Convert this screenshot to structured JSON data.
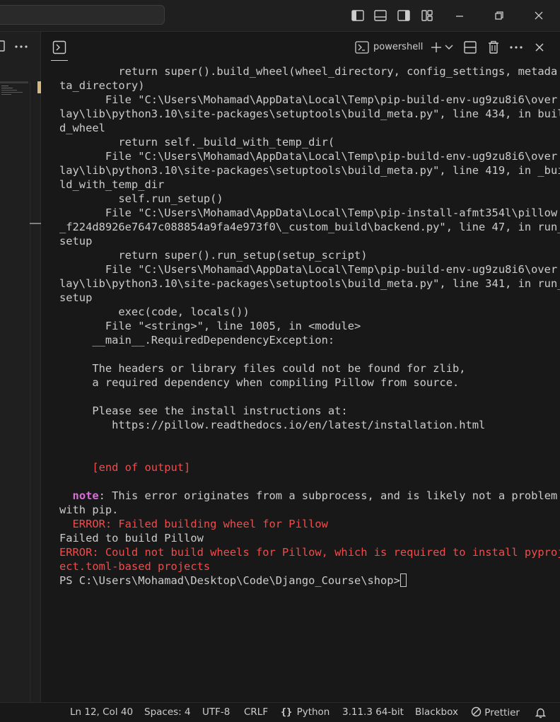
{
  "terminal_tab": {
    "label": "powershell"
  },
  "terminal_lines": [
    {
      "text": "         return super().build_wheel(wheel_directory, config_settings, metada"
    },
    {
      "text": "ta_directory)"
    },
    {
      "text": "       File \"C:\\Users\\Mohamad\\AppData\\Local\\Temp\\pip-build-env-ug9zu8i6\\over"
    },
    {
      "text": "lay\\lib\\python3.10\\site-packages\\setuptools\\build_meta.py\", line 434, in buil"
    },
    {
      "text": "d_wheel"
    },
    {
      "text": "         return self._build_with_temp_dir("
    },
    {
      "text": "       File \"C:\\Users\\Mohamad\\AppData\\Local\\Temp\\pip-build-env-ug9zu8i6\\over"
    },
    {
      "text": "lay\\lib\\python3.10\\site-packages\\setuptools\\build_meta.py\", line 419, in _bui"
    },
    {
      "text": "ld_with_temp_dir"
    },
    {
      "text": "         self.run_setup()"
    },
    {
      "text": "       File \"C:\\Users\\Mohamad\\AppData\\Local\\Temp\\pip-install-afmt354l\\pillow"
    },
    {
      "text": "_f224d8926e7647c088854a9fa4e973f0\\_custom_build\\backend.py\", line 47, in run_"
    },
    {
      "text": "setup"
    },
    {
      "text": "         return super().run_setup(setup_script)"
    },
    {
      "text": "       File \"C:\\Users\\Mohamad\\AppData\\Local\\Temp\\pip-build-env-ug9zu8i6\\over"
    },
    {
      "text": "lay\\lib\\python3.10\\site-packages\\setuptools\\build_meta.py\", line 341, in run_"
    },
    {
      "text": "setup"
    },
    {
      "text": "         exec(code, locals())"
    },
    {
      "text": "       File \"<string>\", line 1005, in <module>"
    },
    {
      "text": "     __main__.RequiredDependencyException:"
    },
    {
      "text": ""
    },
    {
      "text": "     The headers or library files could not be found for zlib,"
    },
    {
      "text": "     a required dependency when compiling Pillow from source."
    },
    {
      "text": ""
    },
    {
      "text": "     Please see the install instructions at:"
    },
    {
      "text": "        https://pillow.readthedocs.io/en/latest/installation.html"
    },
    {
      "text": ""
    },
    {
      "text": ""
    },
    {
      "text": "     [end of output]",
      "color": "red"
    },
    {
      "text": ""
    },
    {
      "prefix": "  ",
      "highlight": "note",
      "text": ": This error originates from a subprocess, and is likely not a problem"
    },
    {
      "text": "with pip."
    },
    {
      "text": "  ERROR: Failed building wheel for Pillow",
      "color": "red"
    },
    {
      "text": "Failed to build Pillow"
    },
    {
      "text": "ERROR: Could not build wheels for Pillow, which is required to install pyproj",
      "color": "red"
    },
    {
      "text": "ect.toml-based projects",
      "color": "red"
    },
    {
      "text": "PS C:\\Users\\Mohamad\\Desktop\\Code\\Django_Course\\shop>",
      "cursor": true
    }
  ],
  "statusbar": {
    "position": "Ln 12, Col 40",
    "spaces": "Spaces: 4",
    "encoding": "UTF-8",
    "eol": "CRLF",
    "language": "Python",
    "interpreter": "3.11.3 64-bit",
    "blackbox": "Blackbox",
    "prettier": "Prettier"
  },
  "colors": {
    "error": "#f14c4c",
    "note": "#d670d6",
    "text": "#cccccc",
    "background": "#181818"
  }
}
